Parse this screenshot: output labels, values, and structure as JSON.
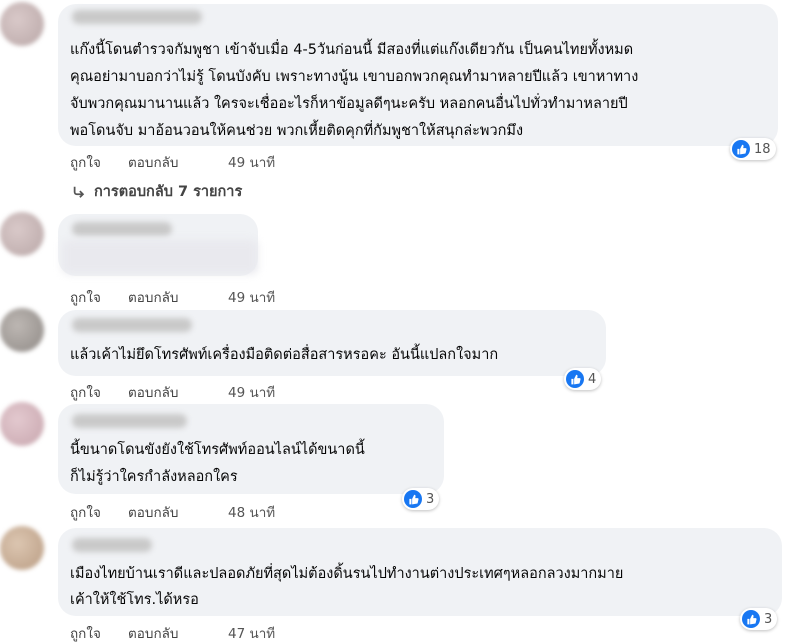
{
  "comments": [
    {
      "lines": [
        "แก๊งนี้โดนตำรวจกัมพูชา เข้าจับเมื่อ 4-5วันก่อนนี้ มีสองที่แต่แก๊งเดียวกัน เป็นคนไทยทั้งหมด",
        "คุณอย่ามาบอกว่าไม่รู้ โดนบังคับ เพราะทางนู้น เขาบอกพวกคุณทำมาหลายปีแล้ว เขาหาทาง",
        "จับพวกคุณมานานแล้ว ใครจะเชื่ออะไรก็หาข้อมูลดีๆนะครับ หลอกคนอื่นไปทั่วทำมาหลายปี",
        "พอโดนจับ มาอ้อนวอนให้คนช่วย พวกเหี้ยติดคุกที่กัมพูชาให้สนุกล่ะพวกมึง"
      ],
      "like_label": "ถูกใจ",
      "reply_label": "ตอบกลับ",
      "time": "49 นาที",
      "reaction_count": "18",
      "replies_link": "การตอบกลับ 7 รายการ"
    },
    {
      "lines": [],
      "like_label": "ถูกใจ",
      "reply_label": "ตอบกลับ",
      "time": "49 นาที"
    },
    {
      "lines": [
        "แล้วเค้าไม่ยึดโทรศัพท์เครื่องมือติดต่อสื่อสารหรอคะ อันนี้แปลกใจมาก"
      ],
      "like_label": "ถูกใจ",
      "reply_label": "ตอบกลับ",
      "time": "49 นาที",
      "reaction_count": "4"
    },
    {
      "lines": [
        "นี้ขนาดโดนขังยังใช้โทรศัพท์ออนไลน์ได้ขนาดนี้",
        "ก็ไม่รู้ว่าใครกำลังหลอกใคร"
      ],
      "like_label": "ถูกใจ",
      "reply_label": "ตอบกลับ",
      "time": "48 นาที",
      "reaction_count": "3"
    },
    {
      "lines": [
        "เมืองไทยบ้านเราดีและปลอดภัยที่สุดไม่ต้องดิ้นรนไปทำงานต่างประเทศๆหลอกลวงมากมาย",
        "เค้าให้ใช้โทร.ได้หรอ"
      ],
      "like_label": "ถูกใจ",
      "reply_label": "ตอบกลับ",
      "time": "47 นาที",
      "reaction_count": "3"
    }
  ],
  "icons": {
    "like": "thumbs-up-icon",
    "reply_arrow": "reply-arrow-icon"
  },
  "colors": {
    "bubble": "#f0f2f5",
    "like_blue": "#1877f2",
    "meta_text": "#444444"
  }
}
